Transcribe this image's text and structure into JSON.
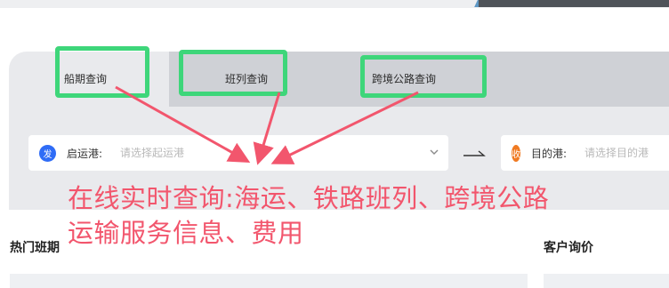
{
  "tabs": [
    {
      "label": "船期查询"
    },
    {
      "label": "班列查询"
    },
    {
      "label": "跨境公路查询"
    }
  ],
  "search": {
    "origin": {
      "badge": "发",
      "label": "启运港:",
      "placeholder": "请选择起运港",
      "badge_color": "#2f6cf6"
    },
    "destination": {
      "badge": "收",
      "label": "目的港:",
      "placeholder": "请选择目的港",
      "badge_color": "#f07a22"
    }
  },
  "annotation": {
    "line1": "在线实时查询:海运、铁路班列、跨境公路",
    "line2": "运输服务信息、费用",
    "color": "#f2566d"
  },
  "sections": {
    "hot_routes_title": "热门班期",
    "inquiry_title": "客户询价"
  },
  "colors": {
    "highlight": "#3ed67a",
    "arrow": "#f2566d"
  }
}
